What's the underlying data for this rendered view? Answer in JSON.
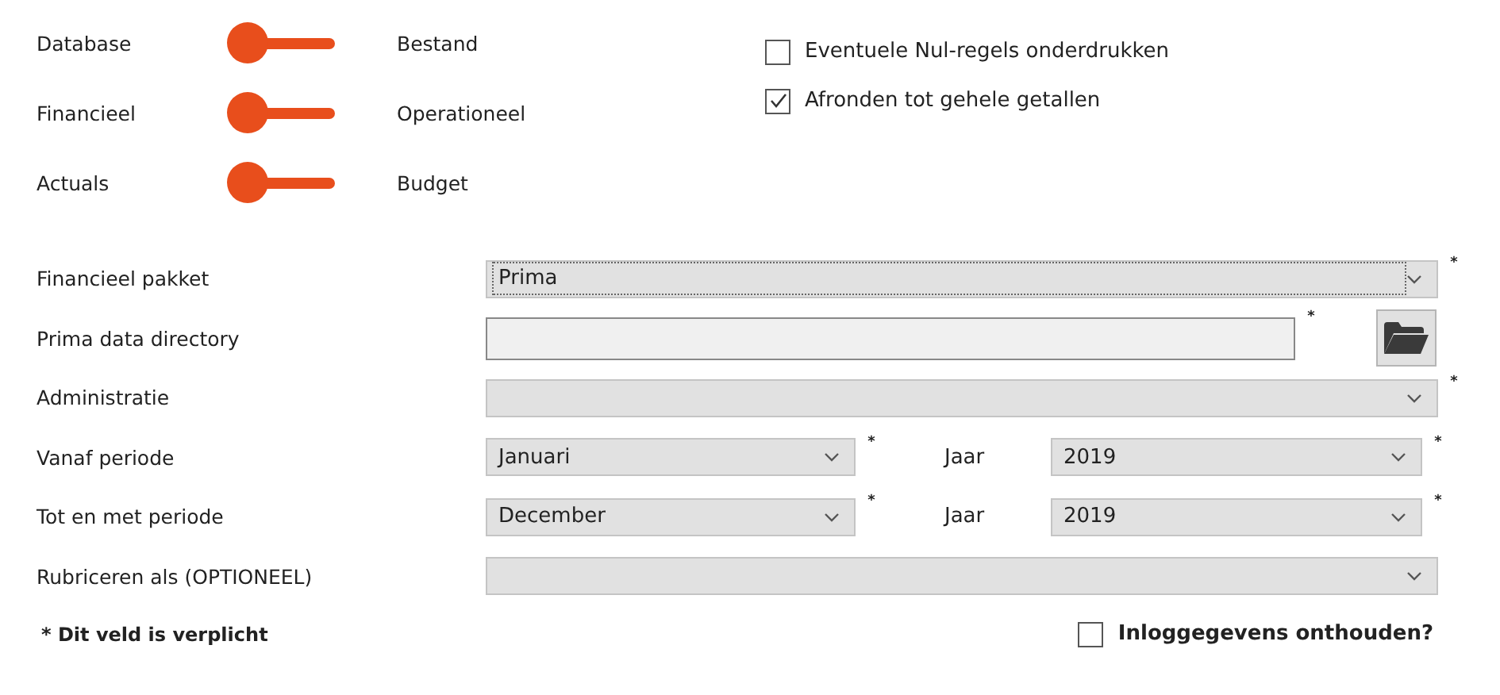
{
  "toggles": [
    {
      "left_label": "Database",
      "right_label": "Bestand",
      "on": false
    },
    {
      "left_label": "Financieel",
      "right_label": "Operationeel",
      "on": false
    },
    {
      "left_label": "Actuals",
      "right_label": "Budget",
      "on": false
    }
  ],
  "options": [
    {
      "label": "Eventuele Nul-regels onderdrukken",
      "checked": false
    },
    {
      "label": "Afronden tot gehele getallen",
      "checked": true
    }
  ],
  "form": [
    {
      "kind": "select",
      "label": "Financieel pakket",
      "value": "Prima",
      "focused": true,
      "mark": "*"
    },
    {
      "kind": "path",
      "label": "Prima data directory",
      "mark": "*"
    },
    {
      "kind": "select",
      "label": "Administratie",
      "focused": false,
      "mark": "*"
    },
    {
      "kind": "period",
      "label": "Vanaf periode",
      "value": "Januari",
      "mark": "*",
      "year_label": "Jaar",
      "year": "2019",
      "year_mark": "*"
    },
    {
      "kind": "period",
      "label": "Tot en met periode",
      "value": "December",
      "mark": "*",
      "year_label": "Jaar",
      "year": "2019",
      "year_mark": "*"
    },
    {
      "kind": "select",
      "label": "Rubriceren als (OPTIONEEL)",
      "focused": false
    }
  ],
  "legend": "* Dit veld is verplicht",
  "remember": {
    "label": "Inloggegevens onthouden?",
    "checked": false
  }
}
